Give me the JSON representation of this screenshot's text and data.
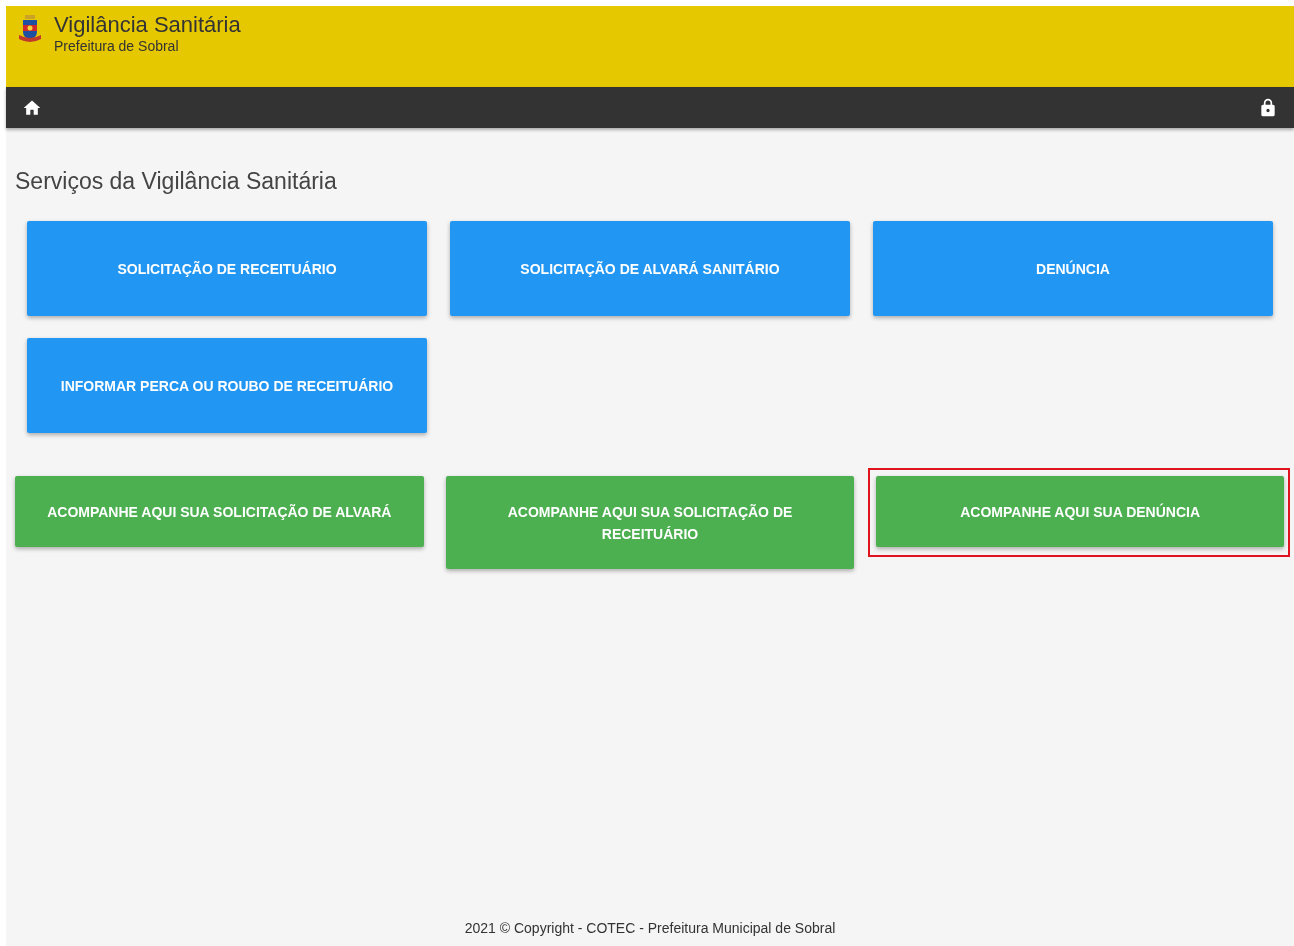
{
  "header": {
    "title": "Vigilância Sanitária",
    "subtitle": "Prefeitura de Sobral"
  },
  "heading": "Serviços da Vigilância Sanitária",
  "services": [
    {
      "label": "SOLICITAÇÃO DE RECEITUÁRIO"
    },
    {
      "label": "SOLICITAÇÃO DE ALVARÁ SANITÁRIO"
    },
    {
      "label": "DENÚNCIA"
    },
    {
      "label": "INFORMAR PERCA OU ROUBO DE RECEITUÁRIO"
    }
  ],
  "tracking": [
    {
      "label": "ACOMPANHE AQUI SUA SOLICITAÇÃO DE ALVARÁ",
      "highlighted": false
    },
    {
      "label": "ACOMPANHE AQUI SUA SOLICITAÇÃO DE RECEITUÁRIO",
      "highlighted": false
    },
    {
      "label": "ACOMPANHE AQUI SUA DENÚNCIA",
      "highlighted": true
    }
  ],
  "footer": "2021 © Copyright - COTEC - Prefeitura Municipal de Sobral"
}
